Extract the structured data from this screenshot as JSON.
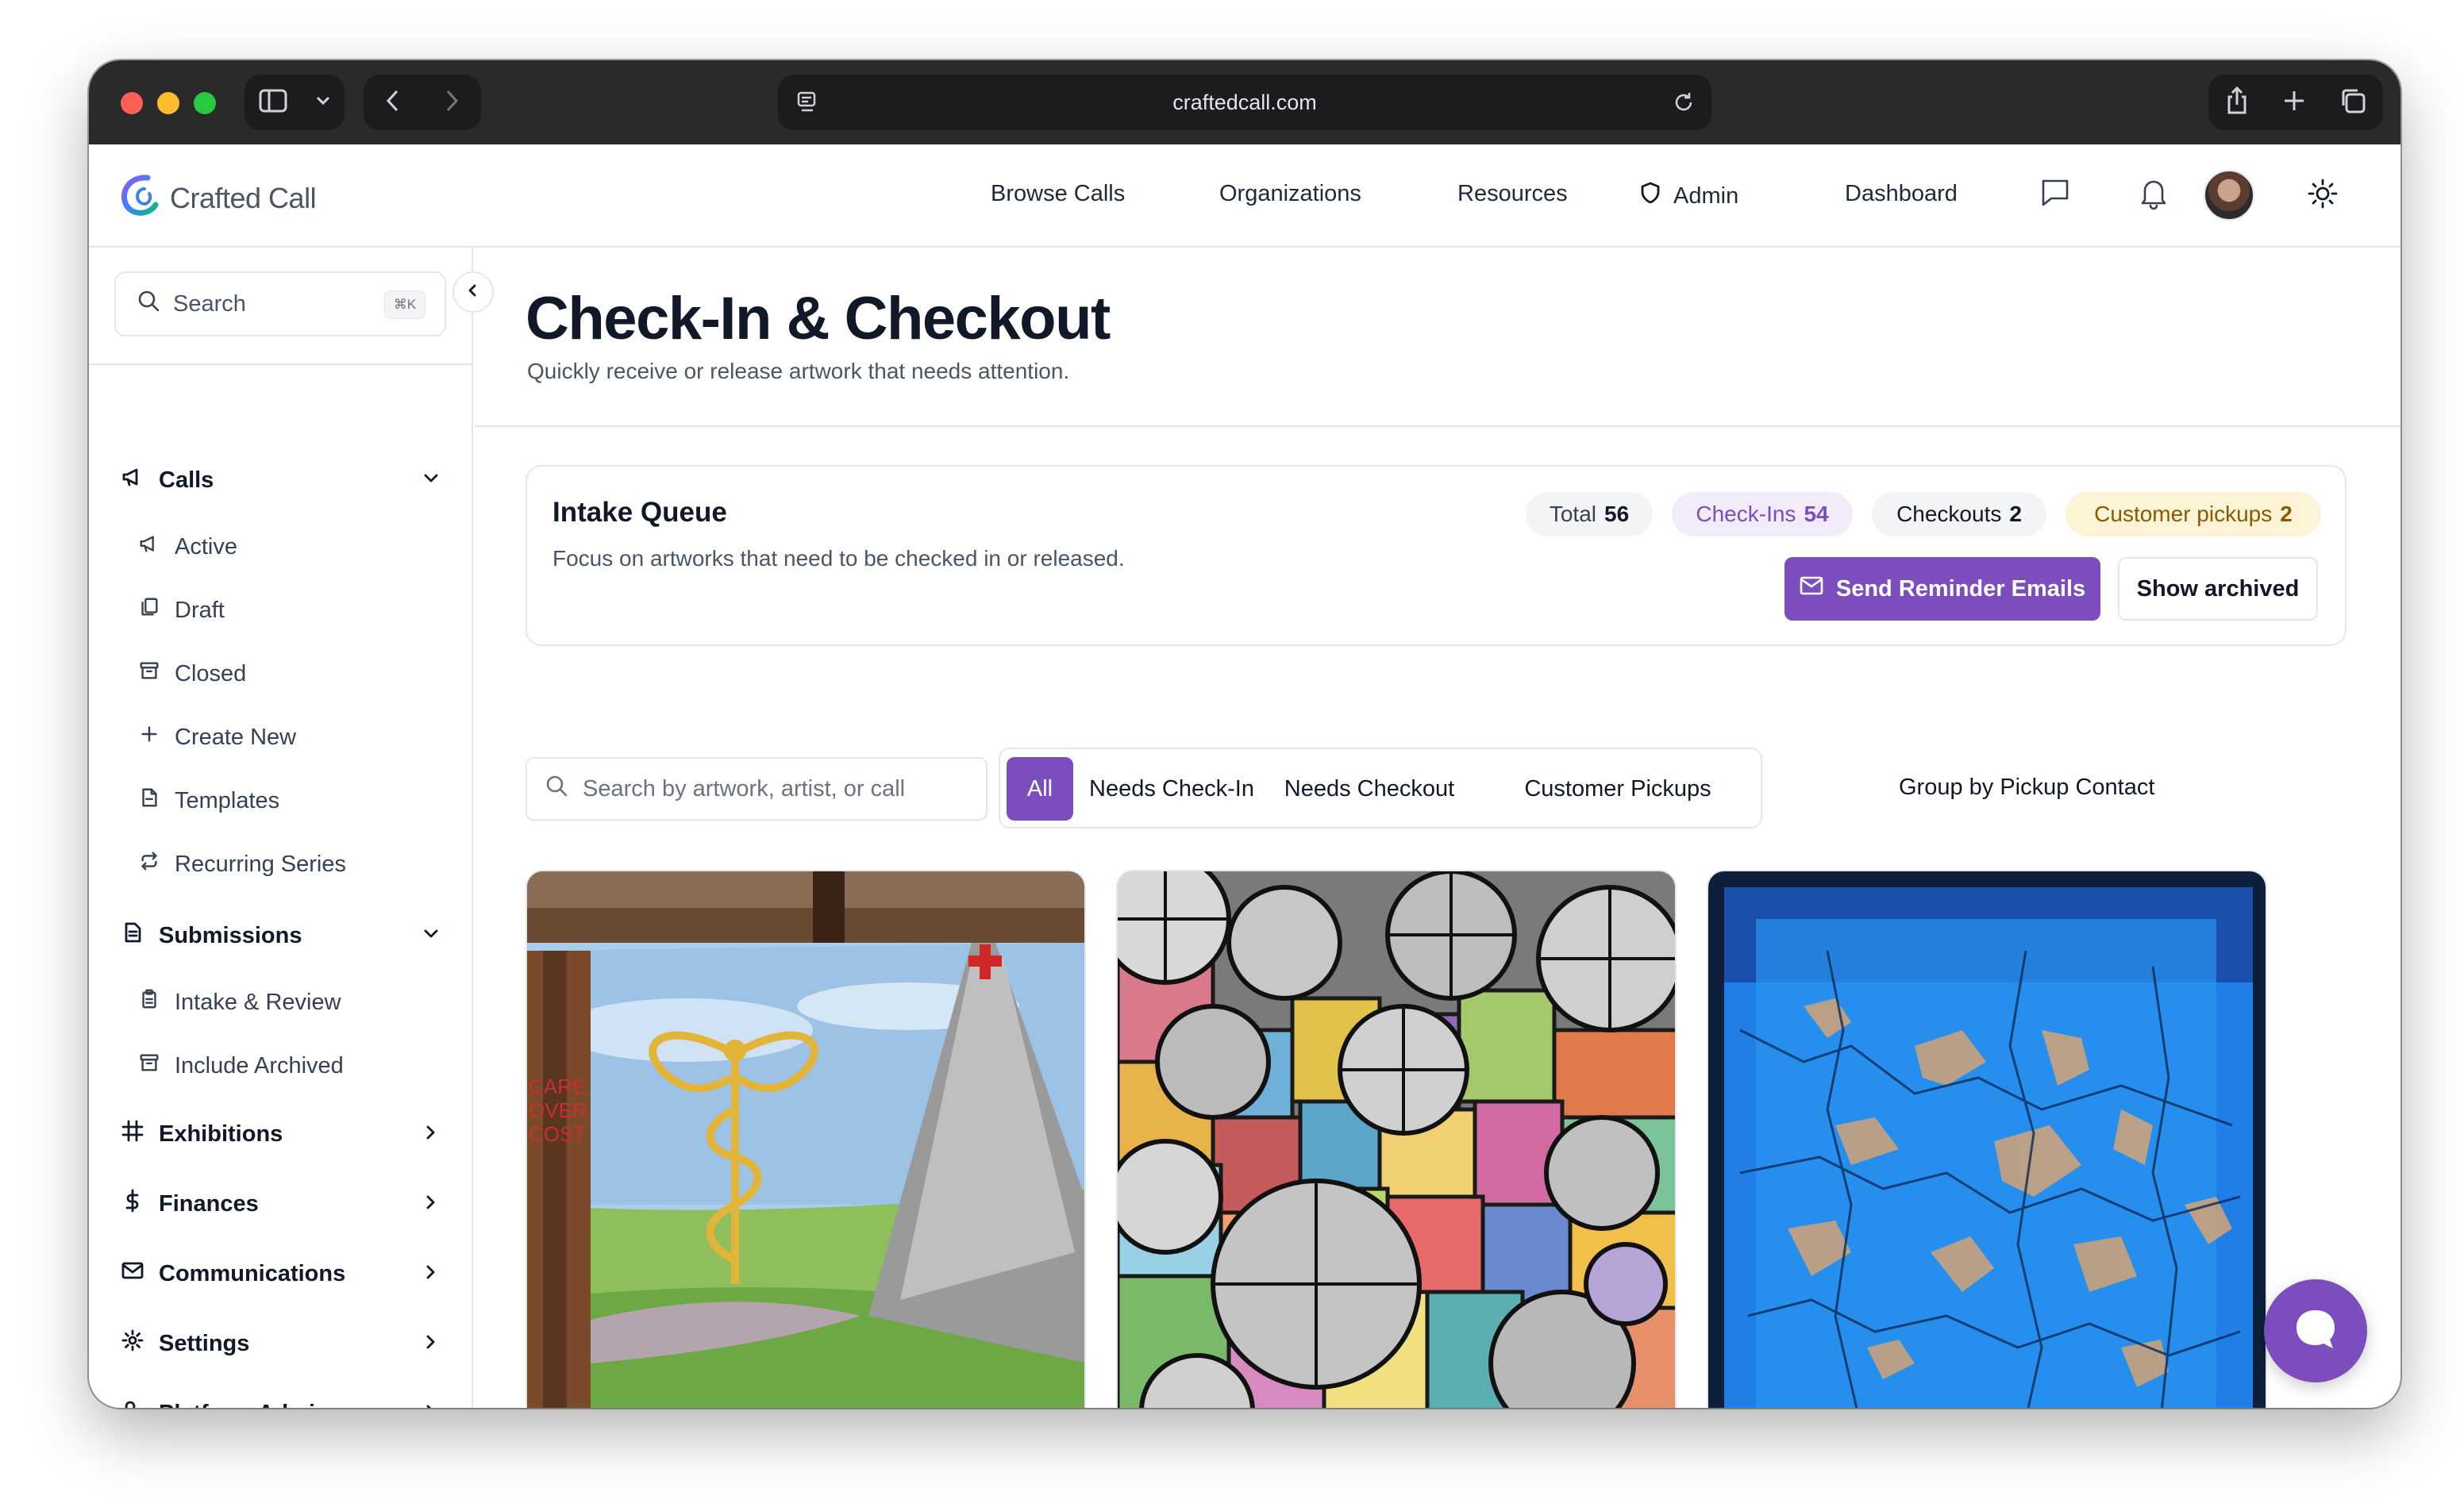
{
  "browser": {
    "url": "craftedcall.com"
  },
  "app": {
    "brand": "Crafted Call",
    "nav": {
      "browse_calls": "Browse Calls",
      "organizations": "Organizations",
      "resources": "Resources",
      "admin": "Admin",
      "dashboard": "Dashboard"
    }
  },
  "sidebar": {
    "search_placeholder": "Search",
    "search_shortcut": "⌘K",
    "calls": {
      "label": "Calls",
      "items": [
        "Active",
        "Draft",
        "Closed",
        "Create New",
        "Templates",
        "Recurring Series"
      ]
    },
    "submissions": {
      "label": "Submissions",
      "items": [
        "Intake & Review",
        "Include Archived"
      ]
    },
    "sections": [
      "Exhibitions",
      "Finances",
      "Communications",
      "Settings",
      "Platform Admin"
    ]
  },
  "page": {
    "title": "Check-In & Checkout",
    "subtitle": "Quickly receive or release artwork that needs attention."
  },
  "queue": {
    "title": "Intake Queue",
    "description": "Focus on artworks that need to be checked in or released.",
    "stats": {
      "total_label": "Total",
      "total_value": "56",
      "checkins_label": "Check-Ins",
      "checkins_value": "54",
      "checkouts_label": "Checkouts",
      "checkouts_value": "2",
      "pickups_label": "Customer pickups",
      "pickups_value": "2"
    },
    "send_reminder": "Send Reminder Emails",
    "show_archived": "Show archived"
  },
  "filters": {
    "search_placeholder": "Search by artwork, artist, or call",
    "tabs": [
      "All",
      "Needs Check-In",
      "Needs Checkout",
      "Customer Pickups"
    ],
    "active_tab": "All",
    "group_by": "Group by Pickup Contact"
  },
  "colors": {
    "accent": "#7c4dbd",
    "checkins_pill_bg": "#f1ebfa",
    "checkins_pill_text": "#7c4dbd",
    "pickups_pill_bg": "#fdf3d6",
    "pickups_pill_text": "#8a5a00"
  }
}
